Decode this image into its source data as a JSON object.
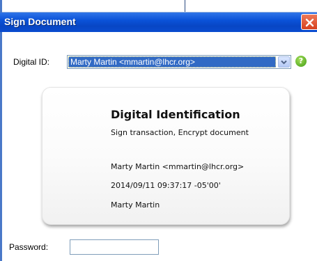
{
  "window": {
    "title": "Sign Document",
    "close_icon": "close-icon"
  },
  "form": {
    "digital_id_label": "Digital ID:",
    "digital_id_value": "Marty Martin <mmartin@lhcr.org>",
    "dropdown_icon": "chevron-down-icon",
    "help_icon_glyph": "?",
    "password_label": "Password:",
    "password_value": ""
  },
  "card": {
    "title": "Digital Identification",
    "usage": "Sign transaction, Encrypt document",
    "subject": "Marty Martin <mmartin@lhcr.org>",
    "timestamp": "2014/09/11 09:37:17 -05'00'",
    "name": "Marty Martin"
  },
  "colors": {
    "titlebar": "#0a52d8",
    "selection": "#316ac5",
    "close": "#d6401e",
    "help": "#3e9a14"
  }
}
